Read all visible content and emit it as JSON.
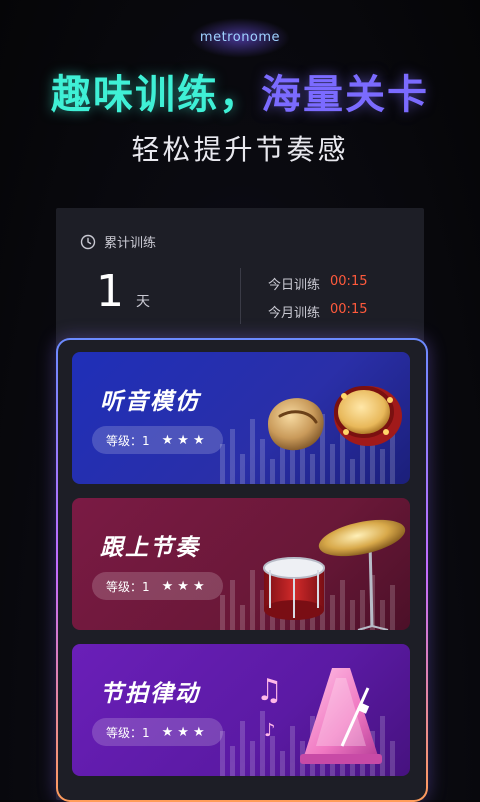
{
  "brand": "metronome",
  "headline": {
    "part1": "趣味训练，",
    "part2": "海量关卡"
  },
  "subline": "轻松提升节奏感",
  "stats": {
    "title": "累计训练",
    "days_value": "1",
    "days_unit": "天",
    "today_label": "今日训练",
    "today_value": "00:15",
    "month_label": "今月训练",
    "month_value": "00:15"
  },
  "cards": [
    {
      "title": "听音模仿",
      "level_label": "等级：1",
      "stars": "★★★",
      "icon": "drums-icon"
    },
    {
      "title": "跟上节奏",
      "level_label": "等级：1",
      "stars": "★★★",
      "icon": "drum-kit-icon"
    },
    {
      "title": "节拍律动",
      "level_label": "等级：1",
      "stars": "★★★",
      "icon": "metronome-icon"
    }
  ],
  "colors": {
    "accent_cyan": "#3ff0d6",
    "accent_purple": "#7b6bff",
    "time_orange": "#ff5a3c",
    "card1": "#1f2fb8",
    "card2": "#7a1a44",
    "card3": "#6a1fb8"
  }
}
